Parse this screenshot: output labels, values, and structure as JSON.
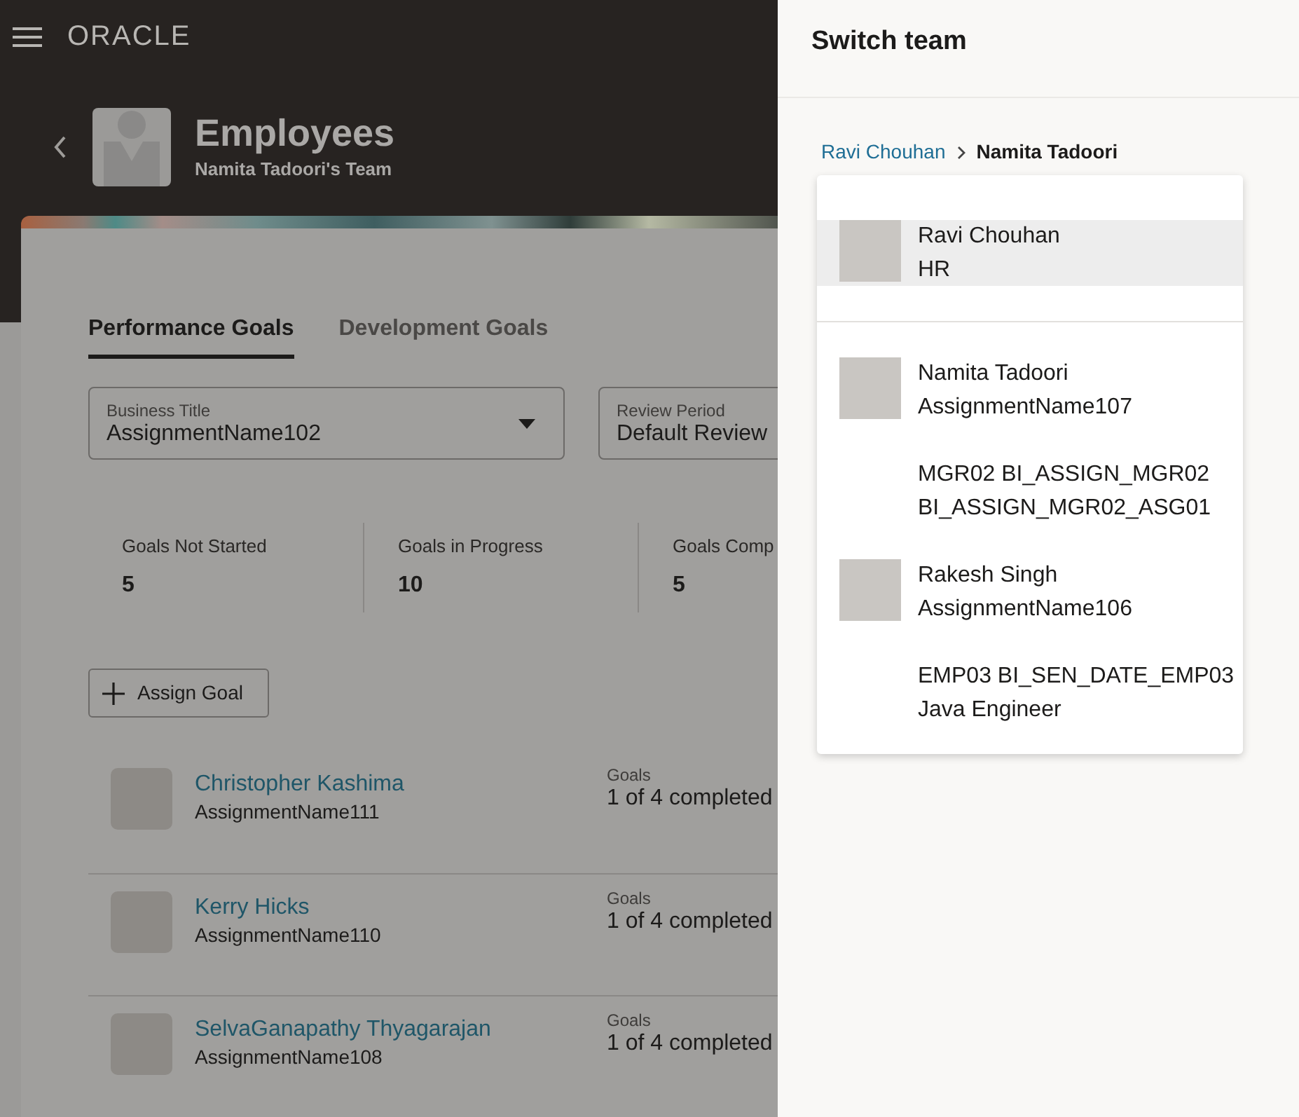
{
  "header": {
    "logo": "ORACLE",
    "title": "Employees",
    "subtitle": "Namita Tadoori's Team"
  },
  "tabs": [
    {
      "label": "Performance Goals",
      "selected": true
    },
    {
      "label": "Development Goals",
      "selected": false
    }
  ],
  "filters": [
    {
      "label": "Business Title",
      "value": "AssignmentName102",
      "dropdown": true
    },
    {
      "label": "Review Period",
      "value": "Default Review",
      "dropdown": false
    }
  ],
  "stats": [
    {
      "label": "Goals Not Started",
      "value": "5"
    },
    {
      "label": "Goals in Progress",
      "value": "10"
    },
    {
      "label": "Goals Comp",
      "value": "5"
    }
  ],
  "assign_button": "Assign Goal",
  "employees": [
    {
      "name": "Christopher Kashima",
      "assignment": "AssignmentName111",
      "goals_label": "Goals",
      "goals_value": "1 of 4 completed"
    },
    {
      "name": "Kerry Hicks",
      "assignment": "AssignmentName110",
      "goals_label": "Goals",
      "goals_value": "1 of 4 completed"
    },
    {
      "name": "SelvaGanapathy Thyagarajan",
      "assignment": "AssignmentName108",
      "goals_label": "Goals",
      "goals_value": "1 of 4 completed"
    }
  ],
  "panel": {
    "title": "Switch team",
    "breadcrumb": [
      {
        "label": "Ravi Chouhan",
        "current": false
      },
      {
        "label": "Namita Tadoori",
        "current": true
      }
    ],
    "managers": [
      {
        "name": "Ravi Chouhan",
        "detail": "HR",
        "photo": true,
        "selected": true
      }
    ],
    "reports": [
      {
        "name": "Namita Tadoori",
        "detail": "AssignmentName107",
        "photo": true,
        "selected": false
      },
      {
        "name": "MGR02 BI_ASSIGN_MGR02",
        "detail": "BI_ASSIGN_MGR02_ASG01",
        "photo": false,
        "selected": false
      },
      {
        "name": "Rakesh Singh",
        "detail": "AssignmentName106",
        "photo": true,
        "selected": false
      },
      {
        "name": "EMP03 BI_SEN_DATE_EMP03",
        "detail": "Java Engineer",
        "photo": false,
        "selected": false
      }
    ]
  }
}
